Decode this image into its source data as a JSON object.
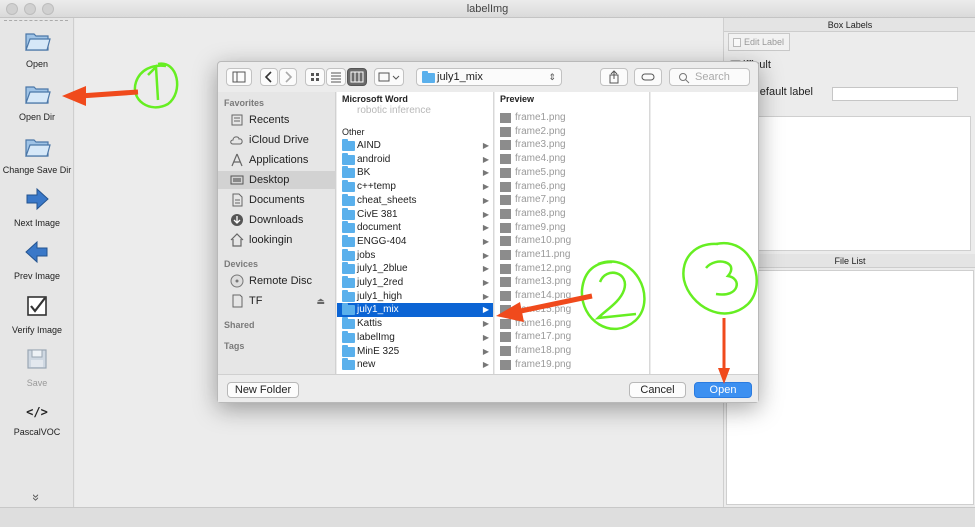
{
  "window": {
    "title": "labelImg"
  },
  "toolbar": {
    "items": [
      {
        "label": "Open",
        "icon": "folder-icon"
      },
      {
        "label": "Open Dir",
        "icon": "folder-open-icon"
      },
      {
        "label": "Change Save Dir",
        "icon": "folder-icon"
      },
      {
        "label": "Next Image",
        "icon": "arrow-right-icon"
      },
      {
        "label": "Prev Image",
        "icon": "arrow-left-icon"
      },
      {
        "label": "Verify Image",
        "icon": "checkbox-icon"
      },
      {
        "label": "Save",
        "icon": "floppy-icon",
        "disabled": true
      },
      {
        "label": "PascalVOC",
        "icon": "code-tag-icon",
        "glyph": "</>"
      }
    ],
    "more_glyph": "»"
  },
  "dock": {
    "box_labels_title": "Box Labels",
    "edit_label": "Edit Label",
    "difficult_label": "difficult",
    "difficult_visible_text": "ifficult",
    "use_default_label": "se default label",
    "file_list_title": "File List"
  },
  "dialog": {
    "path": "july1_mix",
    "search_placeholder": "Search",
    "sidebar": {
      "favorites_head": "Favorites",
      "favorites": [
        "Recents",
        "iCloud Drive",
        "Applications",
        "Desktop",
        "Documents",
        "Downloads",
        "lookingin"
      ],
      "devices_head": "Devices",
      "devices": [
        "Remote Disc",
        "TF"
      ],
      "shared_head": "Shared",
      "tags_head": "Tags",
      "selected": "Desktop"
    },
    "column1": {
      "head": "Microsoft Word",
      "faded_item": "robotic inference",
      "sub_head": "Other",
      "items": [
        "AIND",
        "android",
        "BK",
        "c++temp",
        "cheat_sheets",
        "CivE 381",
        "document",
        "ENGG-404",
        "jobs",
        "july1_2blue",
        "july1_2red",
        "july1_high",
        "july1_mix",
        "Kattis",
        "labelImg",
        "MinE 325",
        "new"
      ],
      "selected": "july1_mix"
    },
    "column2": {
      "head": "Preview",
      "files": [
        "frame1.png",
        "frame2.png",
        "frame3.png",
        "frame4.png",
        "frame5.png",
        "frame6.png",
        "frame7.png",
        "frame8.png",
        "frame9.png",
        "frame10.png",
        "frame11.png",
        "frame12.png",
        "frame13.png",
        "frame14.png",
        "frame15.png",
        "frame16.png",
        "frame17.png",
        "frame18.png",
        "frame19.png"
      ]
    },
    "new_folder": "New Folder",
    "cancel": "Cancel",
    "open": "Open"
  },
  "annotations": {
    "marker_color": "#66ee22",
    "arrow_color": "#f04a1c",
    "markers": [
      "1",
      "2",
      "3"
    ]
  }
}
